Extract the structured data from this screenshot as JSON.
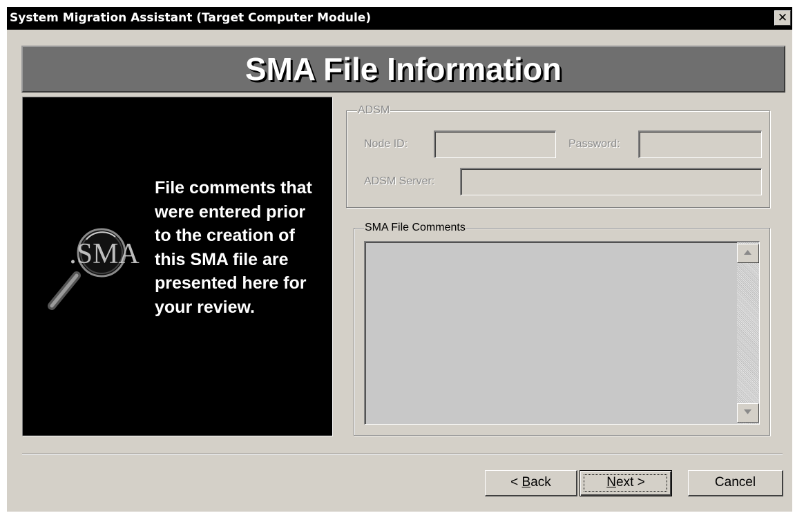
{
  "window": {
    "title": "System Migration Assistant (Target Computer Module)",
    "close_glyph": "✕"
  },
  "banner": {
    "title": "SMA File Information"
  },
  "left_panel": {
    "logo_text": ".SMA",
    "description": "File comments that were entered prior to the creation of this SMA file are presented here for your review."
  },
  "adsm": {
    "legend": "ADSM",
    "node_id_label": "Node ID:",
    "node_id_value": "",
    "password_label": "Password:",
    "password_value": "",
    "server_label": "ADSM Server:",
    "server_value": ""
  },
  "comments": {
    "legend": "SMA File Comments",
    "value": ""
  },
  "buttons": {
    "back": {
      "prefix": "< ",
      "mnemonic": "B",
      "rest": "ack"
    },
    "next": {
      "mnemonic": "N",
      "rest": "ext >"
    },
    "cancel": {
      "label": "Cancel"
    }
  }
}
